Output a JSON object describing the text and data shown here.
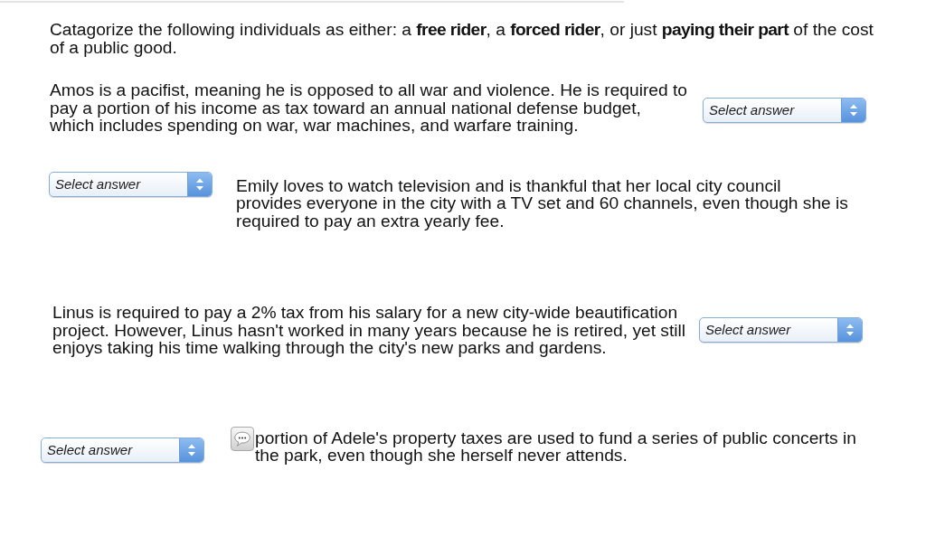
{
  "instructions": "Catagorize the following individuals as either: a **free rider**, a **forced rider**, or just **paying their part** of the cost of a public good.",
  "questions": [
    {
      "kind": "trailing",
      "text": "Amos is a pacifist, meaning he is opposed to all war and violence. He is required to pay a portion of his income as tax toward an annual national defense budget, which includes spending on war, war machines, and warfare training.",
      "dropdown": {
        "placeholder": "Select answer"
      }
    },
    {
      "kind": "leading",
      "text": "Emily loves to watch television and is thankful that her local city council provides everyone in the city with a TV set and 60 channels, even though she is required to pay an extra yearly fee.",
      "dropdown": {
        "placeholder": "Select answer"
      }
    },
    {
      "kind": "trailing",
      "text": "Linus is required to pay a 2% tax from his salary for a new city-wide beautification project. However, Linus hasn't worked in many years because he is retired, yet still enjoys taking his time walking through the city's new parks and gardens.",
      "dropdown": {
        "placeholder": "Select answer"
      }
    },
    {
      "kind": "leading",
      "text": "portion of Adele's property taxes are used to fund a series of public concerts in the park, even though she herself never attends.",
      "comment": true,
      "dropdown": {
        "placeholder": "Select answer"
      }
    }
  ]
}
